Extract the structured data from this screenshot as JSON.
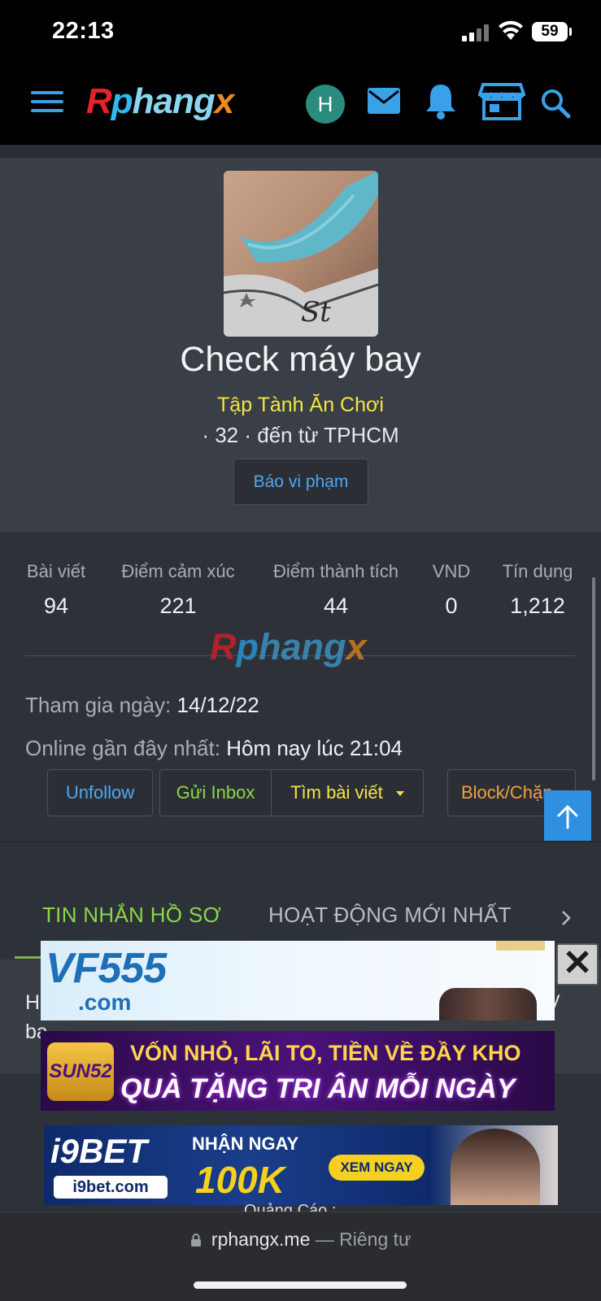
{
  "status": {
    "time": "22:13",
    "battery": "59"
  },
  "nav": {
    "logo": {
      "r": "R",
      "p": "p",
      "h": "hang",
      "x": "x"
    },
    "avatar_letter": "H",
    "icons": [
      "menu-icon",
      "mail-icon",
      "bell-icon",
      "store-icon",
      "search-icon"
    ],
    "accent": "#3aa0e8"
  },
  "profile": {
    "name": "Check máy bay",
    "title": "Tập Tành Ăn Chơi",
    "meta": "· 32 · đến từ TPHCM",
    "report_label": "Báo vi phạm"
  },
  "stats": [
    {
      "label": "Bài viết",
      "value": "94"
    },
    {
      "label": "Điểm cảm xúc",
      "value": "221"
    },
    {
      "label": "Điểm thành tích",
      "value": "44"
    },
    {
      "label": "VND",
      "value": "0"
    },
    {
      "label": "Tín dụng",
      "value": "1,212"
    }
  ],
  "watermark": {
    "r": "R",
    "p": "p",
    "h": "hang",
    "x": "x"
  },
  "info": {
    "joined_label": "Tham gia ngày:",
    "joined_value": "14/12/22",
    "online_label": "Online gần đây nhất:",
    "online_value": "Hôm nay lúc 21:04"
  },
  "actions": {
    "unfollow": "Unfollow",
    "inbox": "Gửi Inbox",
    "find_posts": "Tìm bài viết",
    "block": "Block/Chặn"
  },
  "tabs": {
    "profile_posts": "TIN NHẮN HỒ SƠ",
    "latest_activity": "HOẠT ĐỘNG MỚI NHẤT"
  },
  "cut_text": {
    "left_top": "H",
    "left_bottom": "ba",
    "right": "y"
  },
  "ads": {
    "ad1": {
      "brand": "VF555",
      "sub": ".com"
    },
    "ad2": {
      "brand": "SUN52",
      "line1": "VỐN NHỎ, LÃI TO, TIỀN VỀ ĐẦY KHO",
      "line2": "QUÀ TẶNG TRI ÂN MỖI NGÀY"
    },
    "ad3": {
      "brand": "i9BET",
      "domain": "i9bet.com",
      "headline": "NHẬN NGAY",
      "amount": "100K",
      "cta": "XEM NGAY"
    },
    "footer_label": "Quảng Cáo :"
  },
  "urlbar": {
    "domain": "rphangx.me",
    "suffix": "— Riêng tư"
  }
}
